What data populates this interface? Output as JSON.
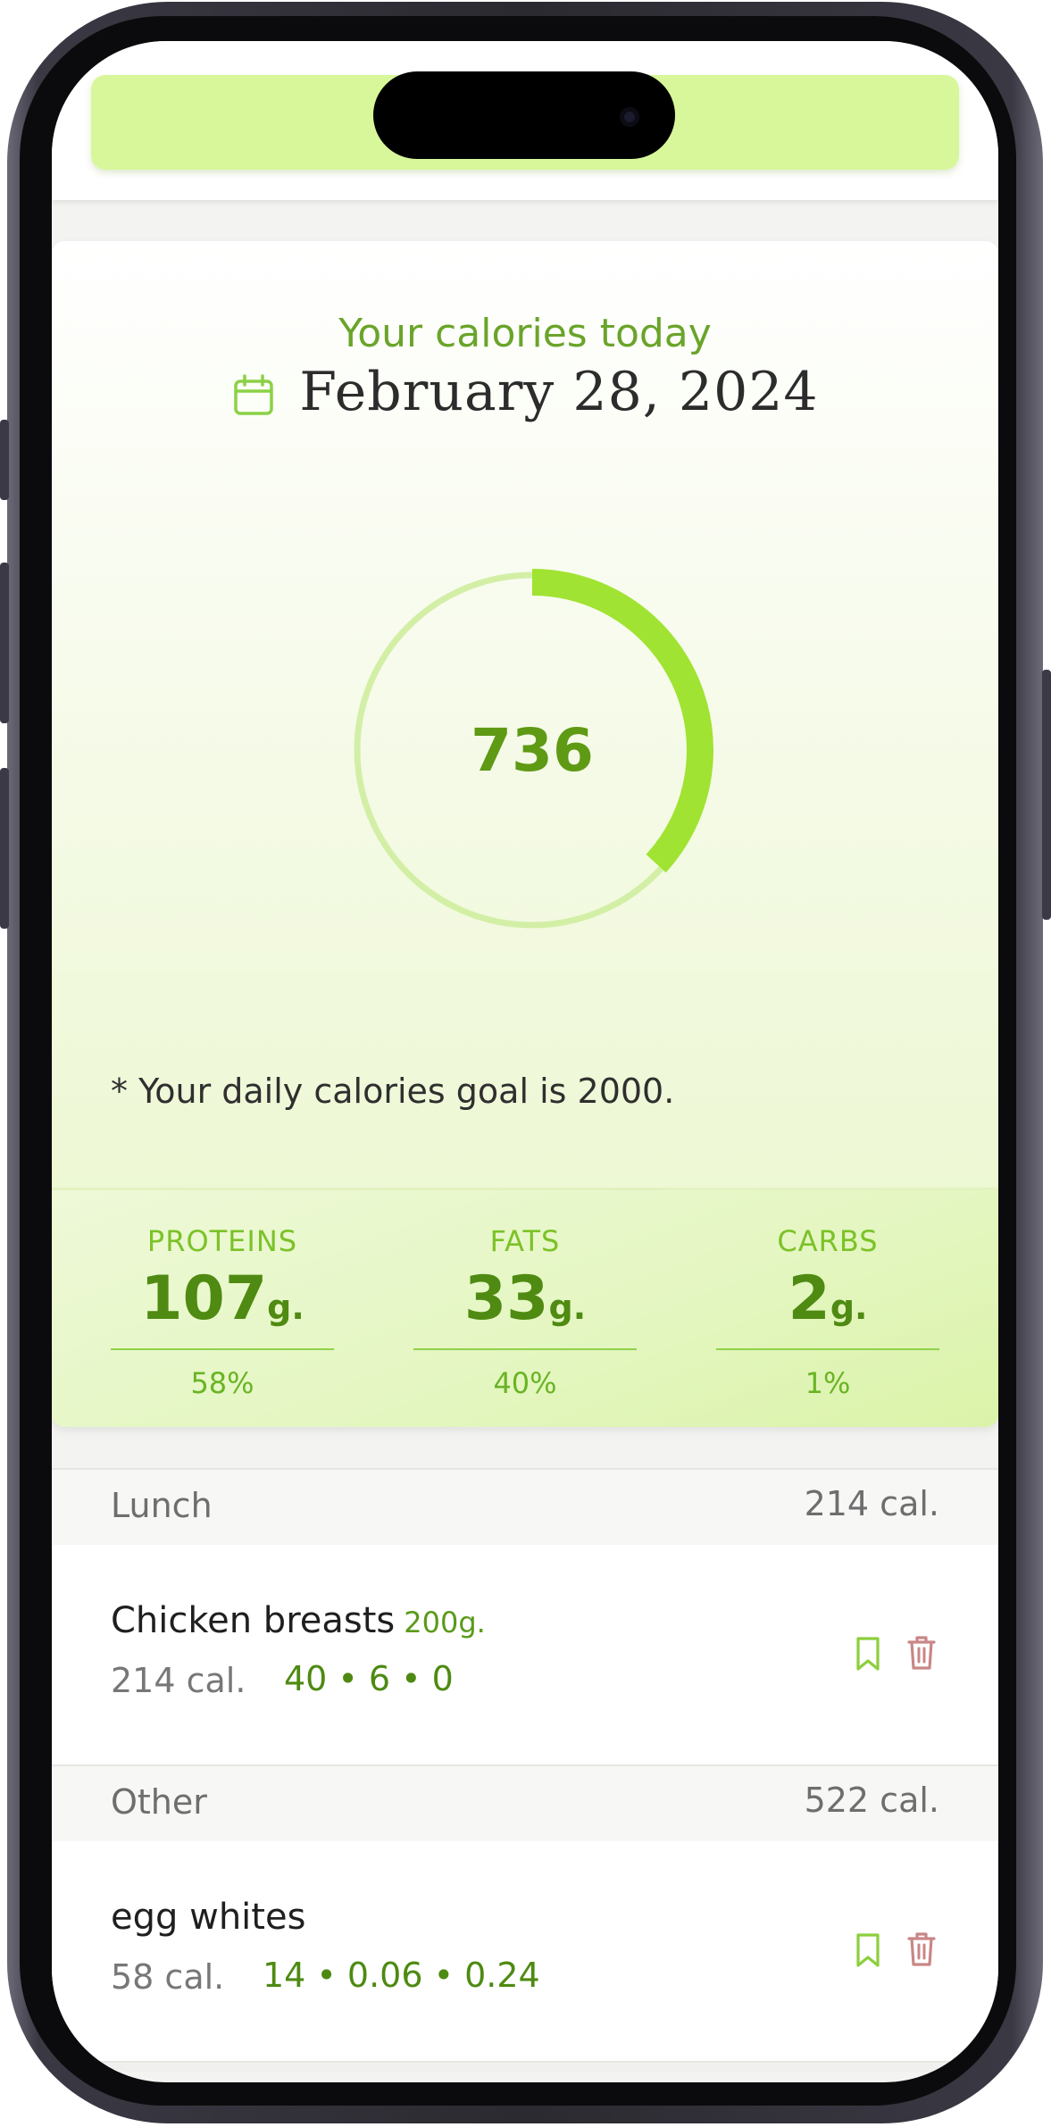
{
  "summary": {
    "heading": "Your calories today",
    "date": "February 28, 2024",
    "calories_consumed": "736",
    "progress_fraction": 0.368,
    "goal_note": "* Your daily calories goal is 2000."
  },
  "macros": [
    {
      "label": "PROTEINS",
      "value": "107",
      "unit": "g.",
      "percent": "58%"
    },
    {
      "label": "FATS",
      "value": "33",
      "unit": "g.",
      "percent": "40%"
    },
    {
      "label": "CARBS",
      "value": "2",
      "unit": "g.",
      "percent": "1%"
    }
  ],
  "meals": [
    {
      "name": "Lunch",
      "calories": "214 cal.",
      "items": [
        {
          "name": "Chicken breasts",
          "quantity": "200g.",
          "calories": "214 cal.",
          "macros": "40 • 6 • 0"
        }
      ]
    },
    {
      "name": "Other",
      "calories": "522 cal.",
      "items": [
        {
          "name": "egg whites",
          "quantity": "",
          "calories": "58 cal.",
          "macros": "14 • 0.06 • 0.24"
        }
      ]
    }
  ],
  "colors": {
    "accent": "#a0e332",
    "accent_dark": "#5e9a14",
    "ring_track": "#d3efa6",
    "delete": "#c98686"
  },
  "icons": {
    "date": "calendar-icon",
    "save": "bookmark-icon",
    "delete": "trash-icon"
  }
}
